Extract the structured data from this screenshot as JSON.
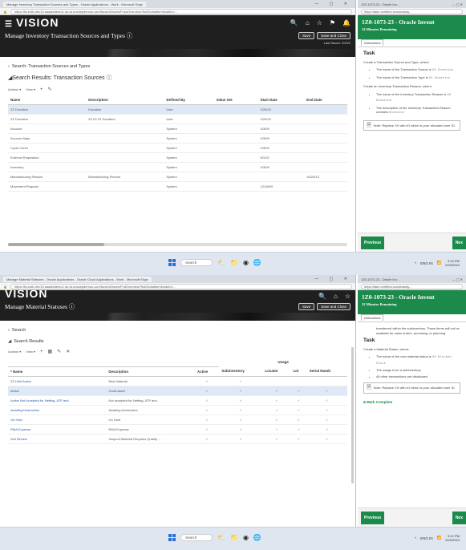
{
  "shot1": {
    "browser": {
      "tab_title": "Manage Inventory Transaction Sources and Types - Oracle Applications - Work - Microsoft Edge",
      "url": "https://fa-eufk-dev19-saasfademo1.ds-fa.oraclepdemos.com/fscmUI/faces/FuseOverview?fndGlobalItemNodeId=..."
    },
    "app": {
      "logo": "VISION",
      "page_title": "Manage Inventory Transaction Sources and Types ⓘ",
      "save_label": "Save",
      "save_close_label": "Save and Close",
      "last_saved": "Last Saved: 2/20/2"
    },
    "search_header": "Search: Transaction Sources and Types",
    "results_header": "Search Results: Transaction Sources ⓘ",
    "toolbar": {
      "actions": "Actions ▾",
      "view": "View ▾",
      "add": "+",
      "edit": "✎"
    },
    "columns": [
      "Name",
      "Description",
      "Defined By",
      "Value Set",
      "Start Date",
      "End Date"
    ],
    "rows": [
      [
        "ZZ Donation",
        "Donation",
        "User",
        "",
        "2/20/24",
        ""
      ],
      [
        "ZZ Donation",
        "ZZ 00 ZZ Donation",
        "User",
        "",
        "2/20/24",
        ""
      ],
      [
        "Account",
        "",
        "System",
        "",
        "4/3/09",
        ""
      ],
      [
        "Account Alias",
        "",
        "System",
        "",
        "4/3/09",
        ""
      ],
      [
        "Cycle Count",
        "",
        "System",
        "",
        "4/3/09",
        ""
      ],
      [
        "External Requisition",
        "",
        "System",
        "",
        "8/1/02",
        ""
      ],
      [
        "Inventory",
        "",
        "System",
        "",
        "4/3/09",
        ""
      ],
      [
        "Manufacturing Rework",
        "Manufacturing Rework",
        "System",
        "",
        "",
        "10/20/13"
      ],
      [
        "Movement Request",
        "",
        "System",
        "",
        "12/18/09",
        ""
      ]
    ],
    "task": {
      "tab_title": "1Z0-1073-23 - Oracle Inv...",
      "url": "https://take.certified.oraclestudy...",
      "title": "1Z0-1073-23 - Oracle Invent",
      "time": "24 Minutes Remaining",
      "tab": "Instructions",
      "heading": "Task",
      "p1": "Create a Transaction Source and Type, where:",
      "b1": "The name of the Transaction Source is",
      "b1_code": "XX Donation",
      "b2": "The name of the Transaction Type is",
      "b2_code": "XX Donation",
      "p2": "Create an Inventory Transaction Reason, where:",
      "b3": "The name of the Inventory Transaction Reason is",
      "b3_code": "XX Donation",
      "b4": "The description of the Inventory Transaction Reason contains",
      "b4_code": "Donation",
      "note": "Note: Replace XX with #1 which is your allocated user ID.",
      "prev": "Previous",
      "next": "Nex"
    }
  },
  "shot2": {
    "browser": {
      "tab_title": "Manage Material Statuses - Oracle Applications - Oracle Cloud Applications - Work - Microsoft Edge",
      "url": "https://fa-eufk-dev19-saasfademo1.ds-fa.oraclepdemos.com/fscmUI/faces/FndOverview?fndGlobalItemNodeId=..."
    },
    "app": {
      "logo": "VISION",
      "page_title": "Manage Material Statuses ⓘ",
      "save_label": "Save",
      "save_close_label": "Save and Close"
    },
    "search_header": "Search",
    "results_header": "Search Results",
    "toolbar": {
      "actions": "Actions ▾",
      "view": "View ▾",
      "add": "+",
      "freeze": "▦",
      "edit": "✎",
      "delete": "✕"
    },
    "usage_header": "Usage",
    "columns": [
      "* Name",
      "Description",
      "Active",
      "Subinventory",
      "Locator",
      "Lot",
      "Serial Numb"
    ],
    "rows": [
      {
        "name": "ZZ Hold Active",
        "desc": "Best Material",
        "active": "✓",
        "sub": "✓",
        "loc": "",
        "lot": "",
        "serial": ""
      },
      {
        "name": "Active",
        "desc": "Good asset",
        "active": "✓",
        "sub": "✓",
        "loc": "✓",
        "lot": "✓",
        "serial": "✓"
      },
      {
        "name": "Active Not Accepted for Netting, ATP and",
        "desc": "Not accepted for Netting, ATP and",
        "active": "✓",
        "sub": "✓",
        "loc": "✓",
        "lot": "✓",
        "serial": "✓"
      },
      {
        "name": "Awaiting Destruction",
        "desc": "Awaiting Destruction",
        "active": "✓",
        "sub": "✓",
        "loc": "✓",
        "lot": "✓",
        "serial": "✓"
      },
      {
        "name": "On Hold",
        "desc": "On Hold",
        "active": "✓",
        "sub": "✓",
        "loc": "✓",
        "lot": "✓",
        "serial": "✓"
      },
      {
        "name": "RMA Expense",
        "desc": "RMA Expense",
        "active": "✓",
        "sub": "✓",
        "loc": "✓",
        "lot": "✓",
        "serial": "✓"
      },
      {
        "name": "Sell Review",
        "desc": "Suspect Material Requires Quality ...",
        "active": "✓",
        "sub": "✓",
        "loc": "✓",
        "lot": "✓",
        "serial": "✓"
      }
    ],
    "task": {
      "tab_title": "1Z0-1073-23 - Oracle Inv...",
      "url": "https://take.certified.oraclestudy...",
      "title": "1Z0-1073-23 - Oracle Invent",
      "time": "22 Minutes Remaining",
      "tab": "Instructions",
      "p0": "transferred within the subinventory. These items will not be available for sales orders, promising, or planning.",
      "heading": "Task",
      "p1": "Create a Material Status, where:",
      "b1": "The name of the new material status is",
      "b1_code": "XX Blocked Stock",
      "b2": "The usage is for a subinventory",
      "b3": "All other transactions are disallowed",
      "note": "Note: Replace XX with #1 which is your allocated user ID.",
      "mark": "Mark Complete",
      "prev": "Previous",
      "next": "Nex"
    }
  },
  "taskbar": {
    "search": "Search",
    "tray1": "ENG IN",
    "time1": "3:10 PM",
    "date1": "2/20/2024",
    "time2": "3:12 PM",
    "date2": "2/20/2024"
  }
}
